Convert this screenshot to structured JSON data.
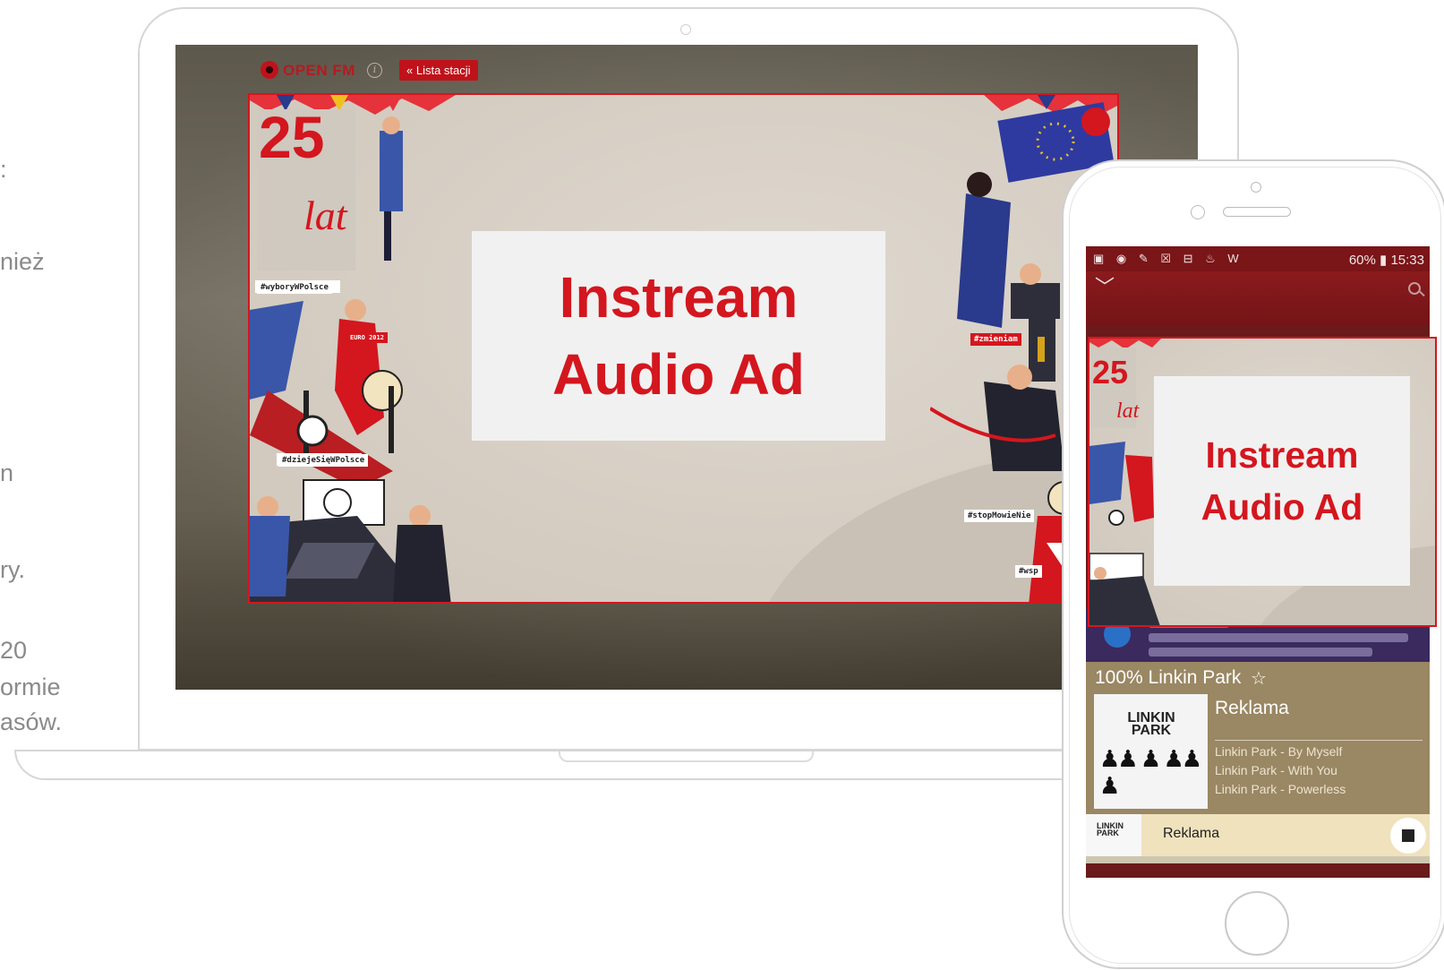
{
  "side_text": {
    "line1": ":",
    "line2": "nież",
    "line3": "n",
    "line4": "ry.",
    "line5": "20",
    "line6": "ormie",
    "line7": "asów."
  },
  "web_player": {
    "brand": "OPEN FM",
    "info_icon": "info-icon",
    "station_list_button": "« Lista stacji"
  },
  "ad": {
    "line1": "Instream",
    "line2": "Audio Ad",
    "accent": "#d4161e",
    "panel_bg": "#f1f1f1"
  },
  "illustration_tags": {
    "tag1": "#wyboryWPolsce",
    "tag2": "#dziejeSięWPolsce",
    "tag3": "#zmieniam",
    "tag4": "#stopMowieNie",
    "tag5": "#wsp",
    "badge": "EURO 2012"
  },
  "phone": {
    "status_time": "60% ▮ 15:33",
    "status_left_icons": "▣ ◉ ✎ ☒ ⊟ ♨ W",
    "app_accent": "#7a1518",
    "artist_title": "100% Linkin Park",
    "album_logo": "LINKIN PARK",
    "now_label": "Reklama",
    "tracks": [
      "Linkin Park - By Myself",
      "Linkin Park - With You",
      "Linkin Park - Powerless"
    ],
    "mini_title": "Reklama",
    "mini_logo": "LINKIN PARK"
  }
}
